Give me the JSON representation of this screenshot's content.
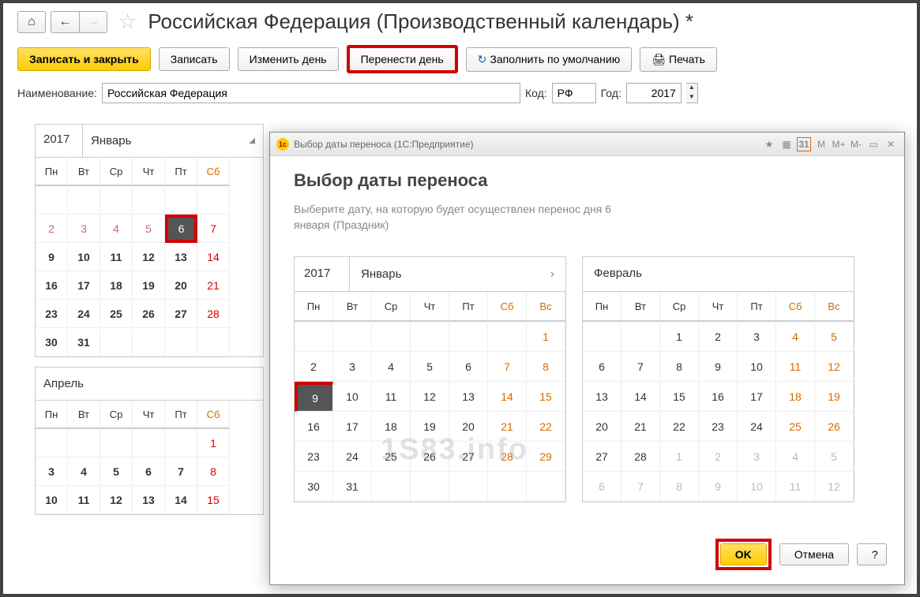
{
  "header": {
    "title": "Российская Федерация (Производственный календарь) *"
  },
  "toolbar": {
    "save_close": "Записать и закрыть",
    "save": "Записать",
    "change_day": "Изменить день",
    "move_day": "Перенести день",
    "fill_default": "Заполнить по умолчанию",
    "print": "Печать"
  },
  "fields": {
    "name_label": "Наименование:",
    "name_value": "Российская Федерация",
    "code_label": "Код:",
    "code_value": "РФ",
    "year_label": "Год:",
    "year_value": "2017"
  },
  "main_cal": {
    "year": "2017",
    "month1": "Январь",
    "month2": "Апрель",
    "days": [
      "Пн",
      "Вт",
      "Ср",
      "Чт",
      "Пт",
      "Сб"
    ],
    "rows1": [
      [
        "",
        "",
        "",
        "",
        "",
        ""
      ],
      [
        "2",
        "3",
        "4",
        "5",
        "6",
        "7"
      ],
      [
        "9",
        "10",
        "11",
        "12",
        "13",
        "14"
      ],
      [
        "16",
        "17",
        "18",
        "19",
        "20",
        "21"
      ],
      [
        "23",
        "24",
        "25",
        "26",
        "27",
        "28"
      ],
      [
        "30",
        "31",
        "",
        "",
        "",
        ""
      ]
    ],
    "rows2": [
      [
        "",
        "",
        "",
        "",
        "",
        "1"
      ],
      [
        "3",
        "4",
        "5",
        "6",
        "7",
        "8"
      ],
      [
        "10",
        "11",
        "12",
        "13",
        "14",
        "15"
      ]
    ]
  },
  "dialog": {
    "title": "Выбор даты переноса  (1С:Предприятие)",
    "heading": "Выбор даты переноса",
    "desc1": "Выберите дату, на которую будет осуществлен перенос дня 6",
    "desc2": "января (Праздник)",
    "cal1": {
      "year": "2017",
      "month": "Январь"
    },
    "cal2": {
      "month": "Февраль"
    },
    "days": [
      "Пн",
      "Вт",
      "Ср",
      "Чт",
      "Пт",
      "Сб",
      "Вс"
    ],
    "jan": [
      [
        "",
        "",
        "",
        "",
        "",
        "",
        "1"
      ],
      [
        "2",
        "3",
        "4",
        "5",
        "6",
        "7",
        "8"
      ],
      [
        "9",
        "10",
        "11",
        "12",
        "13",
        "14",
        "15"
      ],
      [
        "16",
        "17",
        "18",
        "19",
        "20",
        "21",
        "22"
      ],
      [
        "23",
        "24",
        "25",
        "26",
        "27",
        "28",
        "29"
      ],
      [
        "30",
        "31",
        "",
        "",
        "",
        "",
        ""
      ]
    ],
    "feb": [
      [
        "",
        "",
        "1",
        "2",
        "3",
        "4",
        "5"
      ],
      [
        "6",
        "7",
        "8",
        "9",
        "10",
        "11",
        "12"
      ],
      [
        "13",
        "14",
        "15",
        "16",
        "17",
        "18",
        "19"
      ],
      [
        "20",
        "21",
        "22",
        "23",
        "24",
        "25",
        "26"
      ],
      [
        "27",
        "28",
        "1",
        "2",
        "3",
        "4",
        "5"
      ],
      [
        "6",
        "7",
        "8",
        "9",
        "10",
        "11",
        "12"
      ]
    ],
    "ok": "OK",
    "cancel": "Отмена",
    "help": "?",
    "watermark": "1S83.info",
    "titlebar_icons": {
      "m": "M",
      "mplus": "M+",
      "mminus": "M-",
      "cal31": "31"
    }
  }
}
